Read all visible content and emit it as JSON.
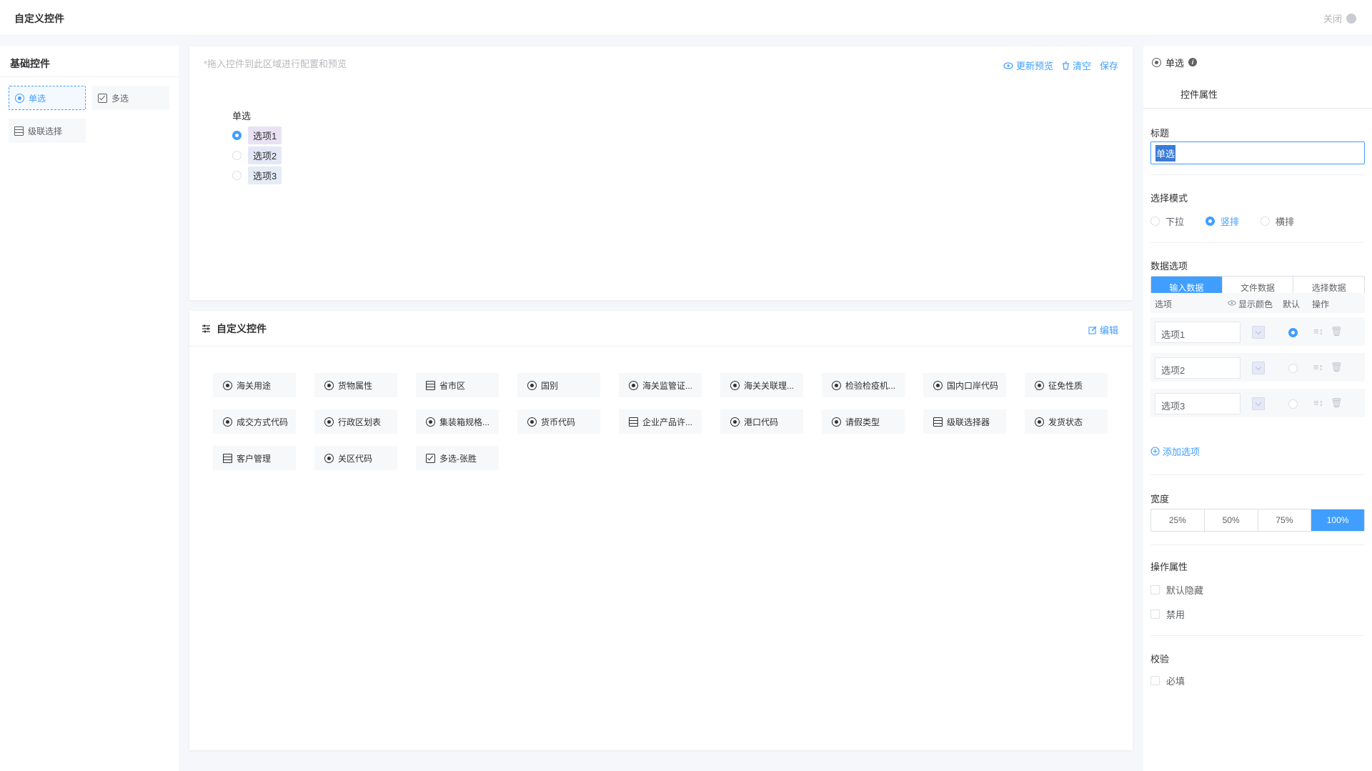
{
  "app": {
    "title": "自定义控件",
    "close_label": "关闭"
  },
  "left": {
    "heading": "基础控件",
    "items": [
      {
        "label": "单选",
        "icon": "radio-icon"
      },
      {
        "label": "多选",
        "icon": "checkbox-icon"
      },
      {
        "label": "级联选择",
        "icon": "cascade-icon"
      }
    ]
  },
  "canvas": {
    "hint": "*拖入控件到此区域进行配置和预览",
    "actions": {
      "preview": "更新预览",
      "clear": "清空",
      "save": "保存"
    },
    "field": {
      "label": "单选",
      "options": [
        "选项1",
        "选项2",
        "选项3"
      ],
      "selected_index": 0,
      "tag_colors": [
        "#e9e2f4",
        "#e4e8f6",
        "#e4ecf6"
      ]
    }
  },
  "custom": {
    "heading": "自定义控件",
    "edit_label": "编辑",
    "chips": [
      {
        "label": "海关用途",
        "icon": "radio"
      },
      {
        "label": "货物属性",
        "icon": "radio"
      },
      {
        "label": "省市区",
        "icon": "cascade"
      },
      {
        "label": "国别",
        "icon": "radio"
      },
      {
        "label": "海关监管证...",
        "icon": "radio"
      },
      {
        "label": "海关关联理...",
        "icon": "radio"
      },
      {
        "label": "检验检疫机...",
        "icon": "radio"
      },
      {
        "label": "国内口岸代码",
        "icon": "radio"
      },
      {
        "label": "征免性质",
        "icon": "radio"
      },
      {
        "label": "成交方式代码",
        "icon": "radio"
      },
      {
        "label": "行政区划表",
        "icon": "radio"
      },
      {
        "label": "集装箱规格...",
        "icon": "radio"
      },
      {
        "label": "货币代码",
        "icon": "radio"
      },
      {
        "label": "企业产品许...",
        "icon": "cascade"
      },
      {
        "label": "港口代码",
        "icon": "radio"
      },
      {
        "label": "请假类型",
        "icon": "radio"
      },
      {
        "label": "级联选择器",
        "icon": "cascade"
      },
      {
        "label": "发货状态",
        "icon": "radio"
      },
      {
        "label": "客户管理",
        "icon": "cascade"
      },
      {
        "label": "关区代码",
        "icon": "radio"
      },
      {
        "label": "多选-张胜",
        "icon": "checkbox"
      }
    ]
  },
  "props": {
    "header_label": "单选",
    "tab_label": "控件属性",
    "title_section": "标题",
    "title_value": "单选",
    "mode_section": "选择模式",
    "modes": [
      "下拉",
      "竖排",
      "横排"
    ],
    "mode_selected": 1,
    "data_section": "数据选项",
    "data_tabs": [
      "输入数据",
      "文件数据",
      "选择数据"
    ],
    "data_tab_selected": 0,
    "table_headers": {
      "option": "选项",
      "color": "显示颜色",
      "default": "默认",
      "action": "操作"
    },
    "options": [
      "选项1",
      "选项2",
      "选项3"
    ],
    "default_index": 0,
    "add_option": "添加选项",
    "width_section": "宽度",
    "widths": [
      "25%",
      "50%",
      "75%",
      "100%"
    ],
    "width_selected": 3,
    "op_section": "操作属性",
    "op_items": [
      "默认隐藏",
      "禁用"
    ],
    "valid_section": "校验",
    "valid_items": [
      "必填"
    ]
  },
  "colors": {
    "accent": "#409eff"
  }
}
